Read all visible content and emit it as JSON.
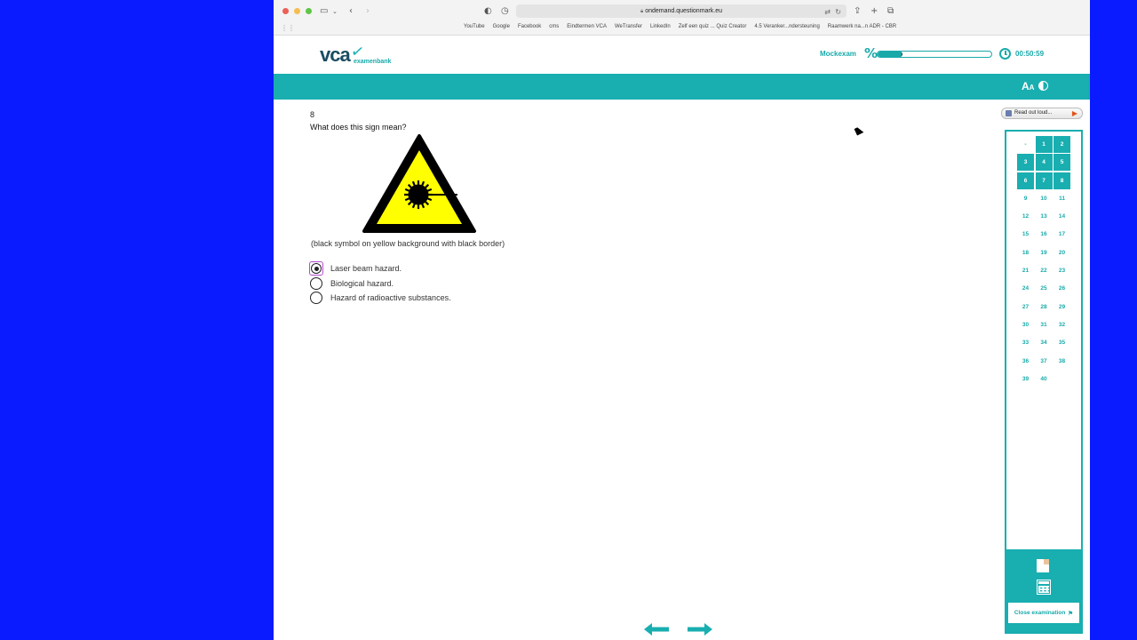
{
  "browser": {
    "url": "ondemand.questionmark.eu",
    "bookmarks": [
      "YouTube",
      "Google",
      "Facebook",
      "cms",
      "Eindtermen VCA",
      "WeTransfer",
      "LinkedIn",
      "Zelf een quiz ... Quiz Creator",
      "4.5 Veranker...ndersteuning",
      "Raamwerk na...n ADR - CBR"
    ]
  },
  "header": {
    "logo_main": "vca",
    "logo_sub": "examenbank",
    "exam_label": "Mockexam",
    "progress_fraction": 0.22,
    "timer": "00:50:59"
  },
  "question": {
    "number": "8",
    "text": "What does this sign mean?",
    "caption": "(black symbol on yellow background with black border)",
    "options": [
      {
        "label": "Laser beam hazard.",
        "selected": true
      },
      {
        "label": "Biological hazard.",
        "selected": false
      },
      {
        "label": "Hazard of radioactive substances.",
        "selected": false
      }
    ]
  },
  "side": {
    "read_aloud": "Read out loud...",
    "close_exam": "Close examination",
    "questions": [
      "-",
      "1",
      "2",
      "3",
      "4",
      "5",
      "6",
      "7",
      "8",
      "9",
      "10",
      "11",
      "12",
      "13",
      "14",
      "15",
      "16",
      "17",
      "18",
      "19",
      "20",
      "21",
      "22",
      "23",
      "24",
      "25",
      "26",
      "27",
      "28",
      "29",
      "30",
      "31",
      "32",
      "33",
      "34",
      "35",
      "36",
      "37",
      "38",
      "39",
      "40"
    ],
    "answered": [
      "1",
      "2",
      "3",
      "4",
      "5",
      "6",
      "7"
    ],
    "current": "8"
  },
  "colors": {
    "teal": "#19aeb0",
    "navy": "#1a4d64",
    "sign_yellow": "#ffff00",
    "selection": "#b34bd0"
  }
}
